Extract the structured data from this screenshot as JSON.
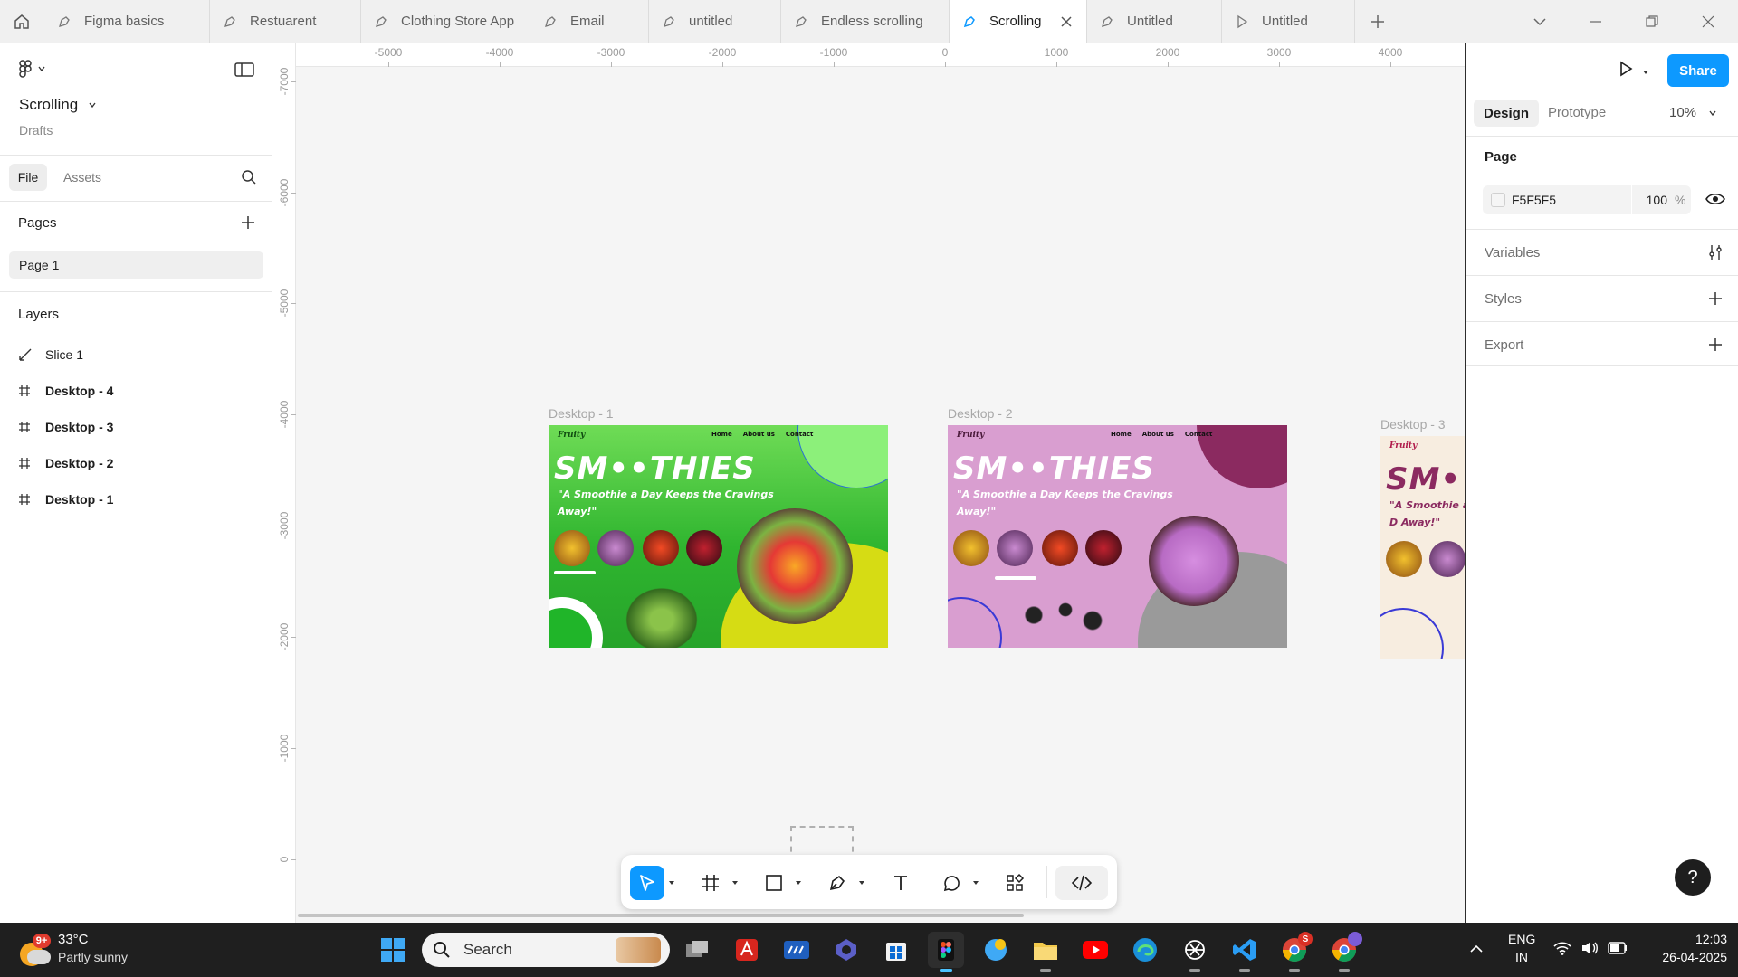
{
  "tabs": [
    {
      "label": "Figma basics",
      "icon": "pen-file-icon"
    },
    {
      "label": "Restuarent",
      "icon": "pen-file-icon"
    },
    {
      "label": "Clothing Store App",
      "icon": "pen-file-icon"
    },
    {
      "label": "Email",
      "icon": "pen-file-icon"
    },
    {
      "label": "untitled",
      "icon": "pen-file-icon"
    },
    {
      "label": "Endless scrolling",
      "icon": "pen-file-icon"
    },
    {
      "label": "Scrolling",
      "icon": "pen-file-icon",
      "active": true
    },
    {
      "label": "Untitled",
      "icon": "pen-file-icon"
    },
    {
      "label": "Untitled",
      "icon": "play-prototype-icon"
    }
  ],
  "file": {
    "name": "Scrolling",
    "location": "Drafts"
  },
  "left_tabs": {
    "file": "File",
    "assets": "Assets"
  },
  "pages": {
    "heading": "Pages",
    "items": [
      "Page 1"
    ]
  },
  "layers": {
    "heading": "Layers",
    "items": [
      {
        "label": "Slice 1",
        "icon": "slice-icon"
      },
      {
        "label": "Desktop - 4",
        "icon": "frame-icon"
      },
      {
        "label": "Desktop - 3",
        "icon": "frame-icon"
      },
      {
        "label": "Desktop - 2",
        "icon": "frame-icon"
      },
      {
        "label": "Desktop - 1",
        "icon": "frame-icon"
      }
    ]
  },
  "ruler": {
    "top": [
      "-5000",
      "-4000",
      "-3000",
      "-2000",
      "-1000",
      "0",
      "1000",
      "2000",
      "3000",
      "4000"
    ],
    "left": [
      "-7000",
      "-6000",
      "-5000",
      "-4000",
      "-3000",
      "-2000",
      "-1000",
      "0"
    ]
  },
  "frames": [
    {
      "label": "Desktop - 1",
      "brand": "Fruity",
      "nav": [
        "Home",
        "About us",
        "Contact"
      ],
      "title": "SM••THIES",
      "subtitle": "\"A Smoothie a Day Keeps the Cravings Away!\"",
      "bg": "#2fb52f"
    },
    {
      "label": "Desktop - 2",
      "brand": "Fruity",
      "nav": [
        "Home",
        "About us",
        "Contact"
      ],
      "title": "SM••THIES",
      "subtitle": "\"A Smoothie a Day Keeps the Cravings Away!\"",
      "bg": "#d99ed0"
    },
    {
      "label": "Desktop - 3",
      "brand": "Fruity",
      "title": "SM•",
      "subtitle": "\"A Smoothie a D Away!\"",
      "bg": "#f7ede0"
    }
  ],
  "right": {
    "share": "Share",
    "tabs": {
      "design": "Design",
      "prototype": "Prototype"
    },
    "zoom": "10%",
    "page_heading": "Page",
    "page_color": "F5F5F5",
    "page_opacity": "100",
    "percent": "%",
    "sections": [
      "Variables",
      "Styles",
      "Export"
    ],
    "help": "?"
  },
  "taskbar": {
    "weather_temp": "33°C",
    "weather_desc": "Partly sunny",
    "weather_badge": "9+",
    "search": "Search",
    "lang": "ENG",
    "region": "IN",
    "time": "12:03",
    "date": "26-04-2025",
    "chrome_badge": "S"
  },
  "colors": {
    "accent": "#0d99ff",
    "frame1": "#2fb52f",
    "frame2": "#d99ed0",
    "frame3": "#f7ede0"
  }
}
